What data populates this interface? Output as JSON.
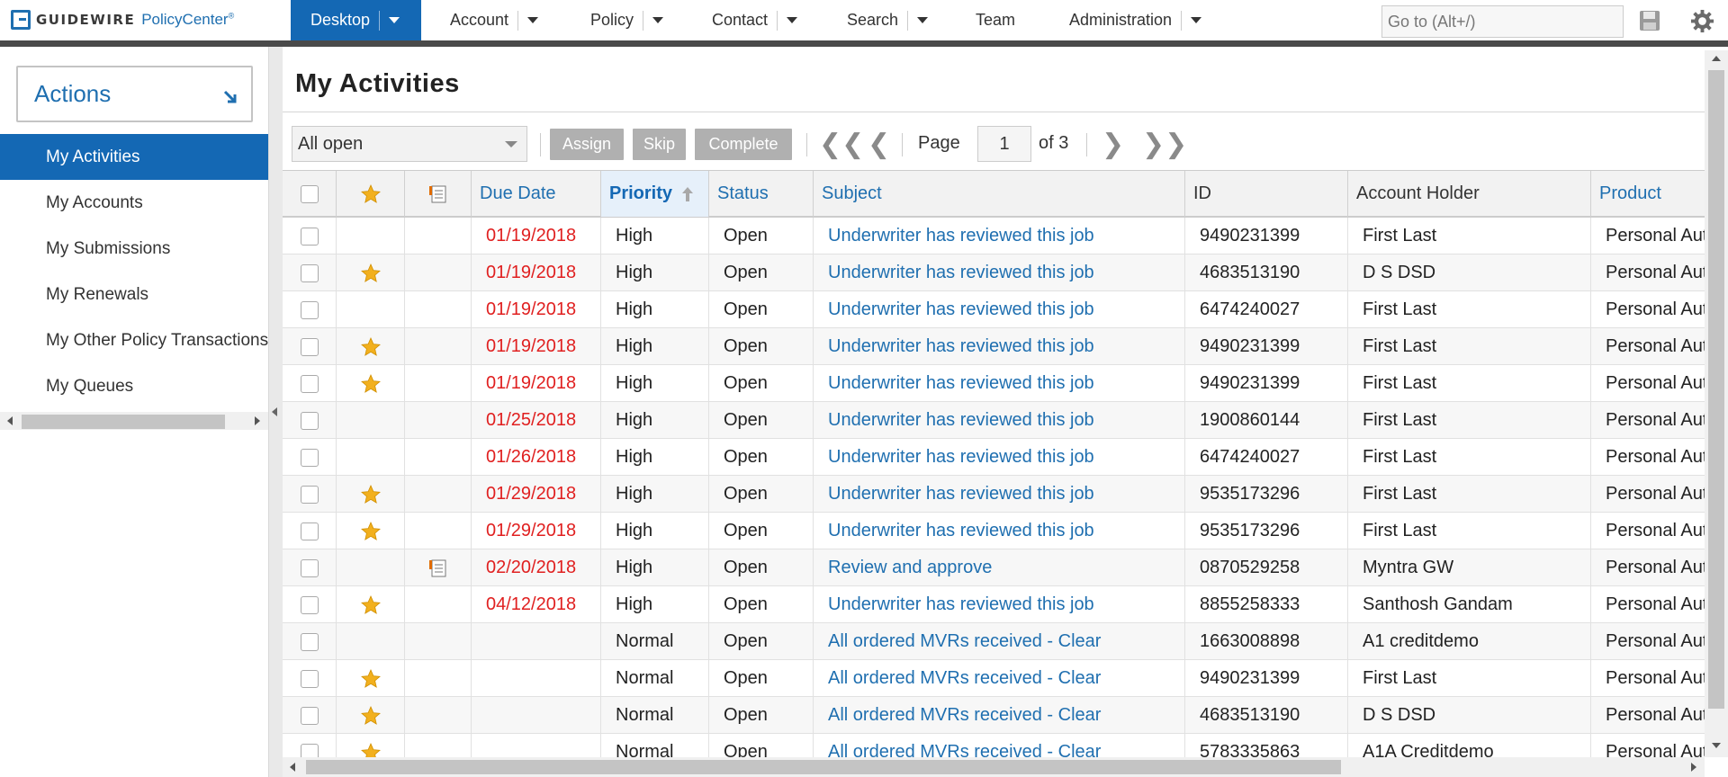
{
  "header": {
    "brand": "GUIDEWIRE",
    "product": "PolicyCenter",
    "trademark": "®",
    "tabs": [
      {
        "label": "Desktop",
        "has_menu": true,
        "active": true
      },
      {
        "label": "Account",
        "has_menu": true
      },
      {
        "label": "Policy",
        "has_menu": true
      },
      {
        "label": "Contact",
        "has_menu": true
      },
      {
        "label": "Search",
        "has_menu": true
      },
      {
        "label": "Team",
        "has_menu": false
      },
      {
        "label": "Administration",
        "has_menu": true
      }
    ],
    "goto_placeholder": "Go to (Alt+/)",
    "accent_color": "#1468b4"
  },
  "sidebar": {
    "actions_label": "Actions",
    "items": [
      {
        "label": "My Activities",
        "active": true
      },
      {
        "label": "My Accounts"
      },
      {
        "label": "My Submissions"
      },
      {
        "label": "My Renewals"
      },
      {
        "label": "My Other Policy Transactions"
      },
      {
        "label": "My Queues"
      }
    ]
  },
  "main": {
    "title": "My Activities",
    "toolbar": {
      "filter_value": "All open",
      "assign_label": "Assign",
      "skip_label": "Skip",
      "complete_label": "Complete",
      "page_label": "Page",
      "page_value": "1",
      "page_of": "of 3"
    },
    "columns": {
      "due_date": "Due Date",
      "priority": "Priority",
      "status": "Status",
      "subject": "Subject",
      "id": "ID",
      "account_holder": "Account Holder",
      "product": "Product"
    },
    "rows": [
      {
        "star": false,
        "note": false,
        "due": "01/19/2018",
        "priority": "High",
        "status": "Open",
        "subject": "Underwriter has reviewed this job",
        "id": "9490231399",
        "holder": "First Last",
        "product": "Personal Auto"
      },
      {
        "star": true,
        "note": false,
        "due": "01/19/2018",
        "priority": "High",
        "status": "Open",
        "subject": "Underwriter has reviewed this job",
        "id": "4683513190",
        "holder": "D S DSD",
        "product": "Personal Auto"
      },
      {
        "star": false,
        "note": false,
        "due": "01/19/2018",
        "priority": "High",
        "status": "Open",
        "subject": "Underwriter has reviewed this job",
        "id": "6474240027",
        "holder": "First Last",
        "product": "Personal Auto"
      },
      {
        "star": true,
        "note": false,
        "due": "01/19/2018",
        "priority": "High",
        "status": "Open",
        "subject": "Underwriter has reviewed this job",
        "id": "9490231399",
        "holder": "First Last",
        "product": "Personal Auto"
      },
      {
        "star": true,
        "note": false,
        "due": "01/19/2018",
        "priority": "High",
        "status": "Open",
        "subject": "Underwriter has reviewed this job",
        "id": "9490231399",
        "holder": "First Last",
        "product": "Personal Auto"
      },
      {
        "star": false,
        "note": false,
        "due": "01/25/2018",
        "priority": "High",
        "status": "Open",
        "subject": "Underwriter has reviewed this job",
        "id": "1900860144",
        "holder": "First Last",
        "product": "Personal Auto"
      },
      {
        "star": false,
        "note": false,
        "due": "01/26/2018",
        "priority": "High",
        "status": "Open",
        "subject": "Underwriter has reviewed this job",
        "id": "6474240027",
        "holder": "First Last",
        "product": "Personal Auto"
      },
      {
        "star": true,
        "note": false,
        "due": "01/29/2018",
        "priority": "High",
        "status": "Open",
        "subject": "Underwriter has reviewed this job",
        "id": "9535173296",
        "holder": "First Last",
        "product": "Personal Auto"
      },
      {
        "star": true,
        "note": false,
        "due": "01/29/2018",
        "priority": "High",
        "status": "Open",
        "subject": "Underwriter has reviewed this job",
        "id": "9535173296",
        "holder": "First Last",
        "product": "Personal Auto"
      },
      {
        "star": false,
        "note": true,
        "due": "02/20/2018",
        "priority": "High",
        "status": "Open",
        "subject": "Review and approve",
        "id": "0870529258",
        "holder": "Myntra GW",
        "product": "Personal Auto"
      },
      {
        "star": true,
        "note": false,
        "due": "04/12/2018",
        "priority": "High",
        "status": "Open",
        "subject": "Underwriter has reviewed this job",
        "id": "8855258333",
        "holder": "Santhosh Gandam",
        "product": "Personal Auto"
      },
      {
        "star": false,
        "note": false,
        "due": "",
        "priority": "Normal",
        "status": "Open",
        "subject": "All ordered MVRs received - Clear",
        "id": "1663008898",
        "holder": "A1 creditdemo",
        "product": "Personal Auto"
      },
      {
        "star": true,
        "note": false,
        "due": "",
        "priority": "Normal",
        "status": "Open",
        "subject": "All ordered MVRs received - Clear",
        "id": "9490231399",
        "holder": "First Last",
        "product": "Personal Auto"
      },
      {
        "star": true,
        "note": false,
        "due": "",
        "priority": "Normal",
        "status": "Open",
        "subject": "All ordered MVRs received - Clear",
        "id": "4683513190",
        "holder": "D S DSD",
        "product": "Personal Auto"
      },
      {
        "star": true,
        "note": false,
        "due": "",
        "priority": "Normal",
        "status": "Open",
        "subject": "All ordered MVRs received - Clear",
        "id": "5783335863",
        "holder": "A1A Creditdemo",
        "product": "Personal Auto"
      }
    ]
  },
  "colors": {
    "link": "#1f6fb0",
    "overdue": "#e02020",
    "star": "#f2b01e",
    "disabled_button": "#b0b0b0"
  }
}
